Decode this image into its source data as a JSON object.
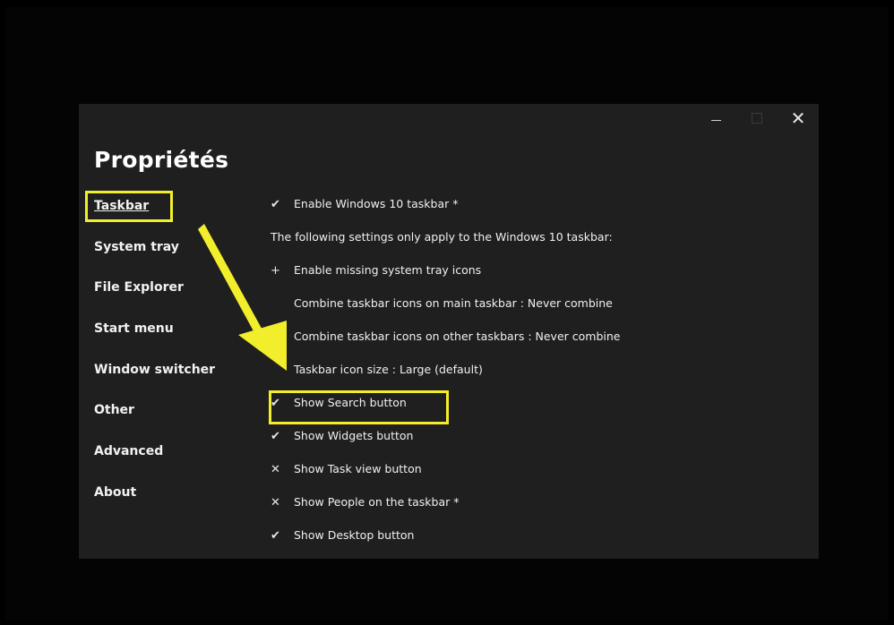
{
  "window": {
    "title": "Propriétés",
    "controls": {
      "minimize_icon": "minimize-icon",
      "maximize_icon": "maximize-icon",
      "close_label": "✕"
    }
  },
  "sidebar": {
    "items": [
      {
        "label": "Taskbar",
        "active": true
      },
      {
        "label": "System tray"
      },
      {
        "label": "File Explorer"
      },
      {
        "label": "Start menu"
      },
      {
        "label": "Window switcher"
      },
      {
        "label": "Other"
      },
      {
        "label": "Advanced"
      },
      {
        "label": "About"
      }
    ]
  },
  "settings": {
    "enable_taskbar": {
      "glyph": "✔",
      "label": "Enable Windows 10 taskbar *"
    },
    "note": "The following settings only apply to the Windows 10 taskbar:",
    "missing_tray": {
      "glyph": "+",
      "label": "Enable missing system tray icons"
    },
    "combine_main": "Combine taskbar icons on main taskbar : Never combine",
    "combine_other": "Combine taskbar icons on other taskbars : Never combine",
    "icon_size": "Taskbar icon size : Large (default)",
    "search_button": {
      "glyph": "✔",
      "label": "Show Search button"
    },
    "widgets_button": {
      "glyph": "✔",
      "label": "Show Widgets button"
    },
    "task_view_button": {
      "glyph": "✕",
      "label": "Show Task view button"
    },
    "people": {
      "glyph": "✕",
      "label": "Show People on the taskbar *"
    },
    "desktop_button": {
      "glyph": "✔",
      "label": "Show Desktop button"
    }
  },
  "annotation_color": "#f2ee2c"
}
